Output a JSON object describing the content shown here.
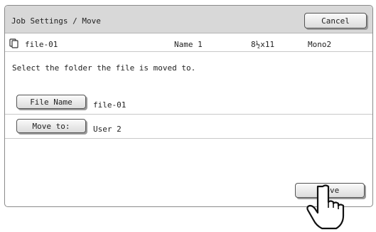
{
  "header": {
    "title": "Job Settings / Move",
    "cancel_label": "Cancel"
  },
  "file": {
    "icon": "document-stack-icon",
    "name": "file-01",
    "user": "Name 1",
    "paper_size": "8½x11",
    "color_mode": "Mono2"
  },
  "instruction": "Select the folder the file is moved to.",
  "fields": {
    "file_name_label": "File Name",
    "file_name_value": "file-01",
    "move_to_label": "Move to:",
    "move_to_value": "User 2"
  },
  "actions": {
    "move_label": "Move"
  },
  "colors": {
    "header_bg": "#d8d8d8",
    "button_border": "#555555"
  }
}
